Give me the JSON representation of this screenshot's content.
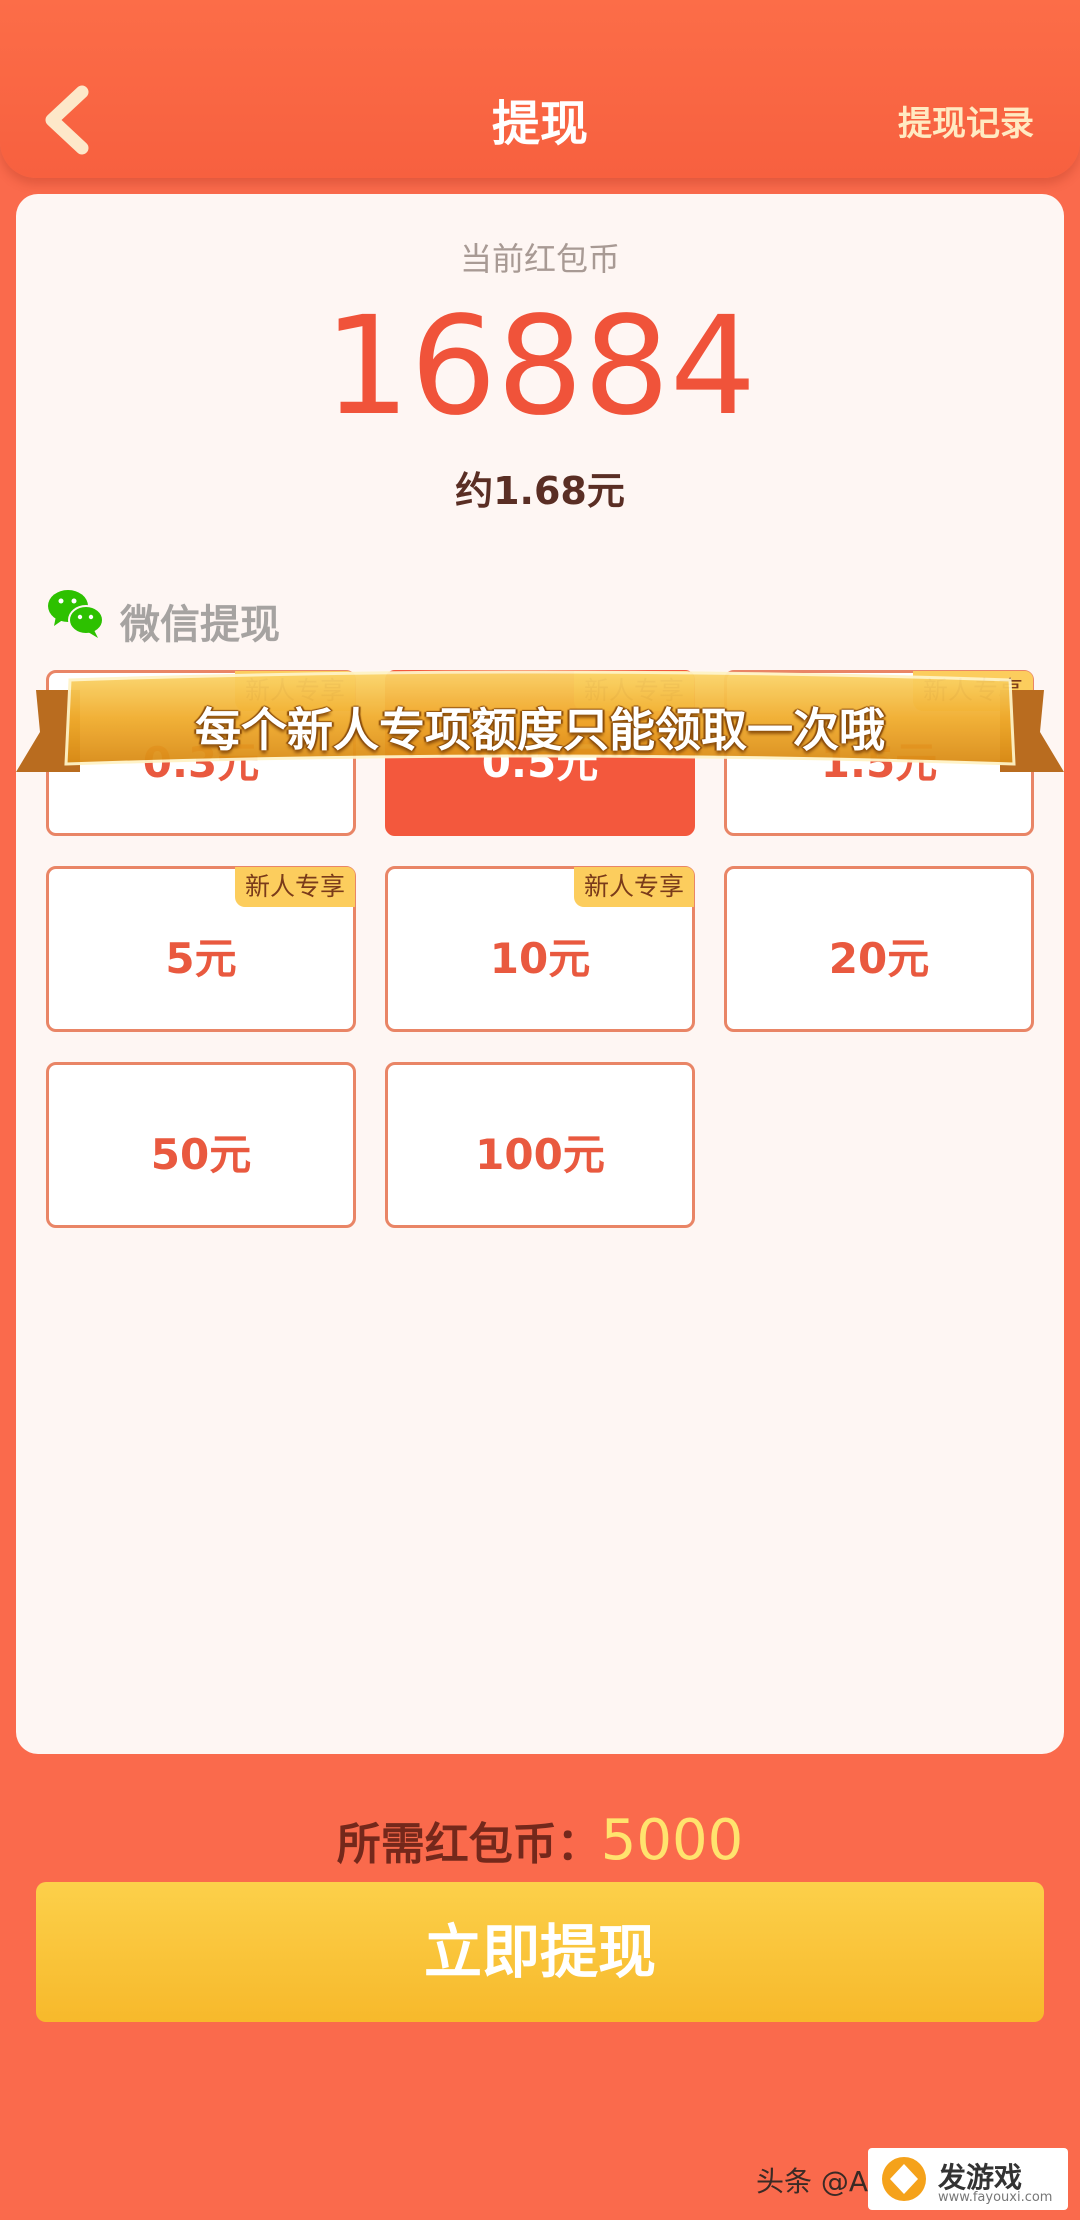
{
  "header": {
    "title": "提现",
    "record_label": "提现记录"
  },
  "balance": {
    "label": "当前红包币",
    "value": "16884",
    "approx": "约1.68元"
  },
  "withdraw_method": {
    "label": "微信提现",
    "icon": "wechat-icon"
  },
  "options": [
    {
      "amount": "0.3元",
      "badge": "新人专享",
      "selected": false
    },
    {
      "amount": "0.5元",
      "badge": "新人专享",
      "selected": true
    },
    {
      "amount": "1.5元",
      "badge": "新人专享",
      "selected": false
    },
    {
      "amount": "5元",
      "badge": "新人专享",
      "selected": false
    },
    {
      "amount": "10元",
      "badge": "新人专享",
      "selected": false
    },
    {
      "amount": "20元",
      "badge": "",
      "selected": false
    },
    {
      "amount": "50元",
      "badge": "",
      "selected": false
    },
    {
      "amount": "100元",
      "badge": "",
      "selected": false
    }
  ],
  "toast": "每个新人专项额度只能领取一次哦",
  "required": {
    "label": "所需红包币：",
    "value": "5000"
  },
  "cta_label": "立即提现",
  "watermark": {
    "text": "头条 @A",
    "site": "发游戏",
    "url": "www.fayouxi.com"
  },
  "colors": {
    "background": "#fa6a4c",
    "accent": "#f0533a",
    "button": "#f9c53a",
    "badge": "#fccd5d"
  }
}
